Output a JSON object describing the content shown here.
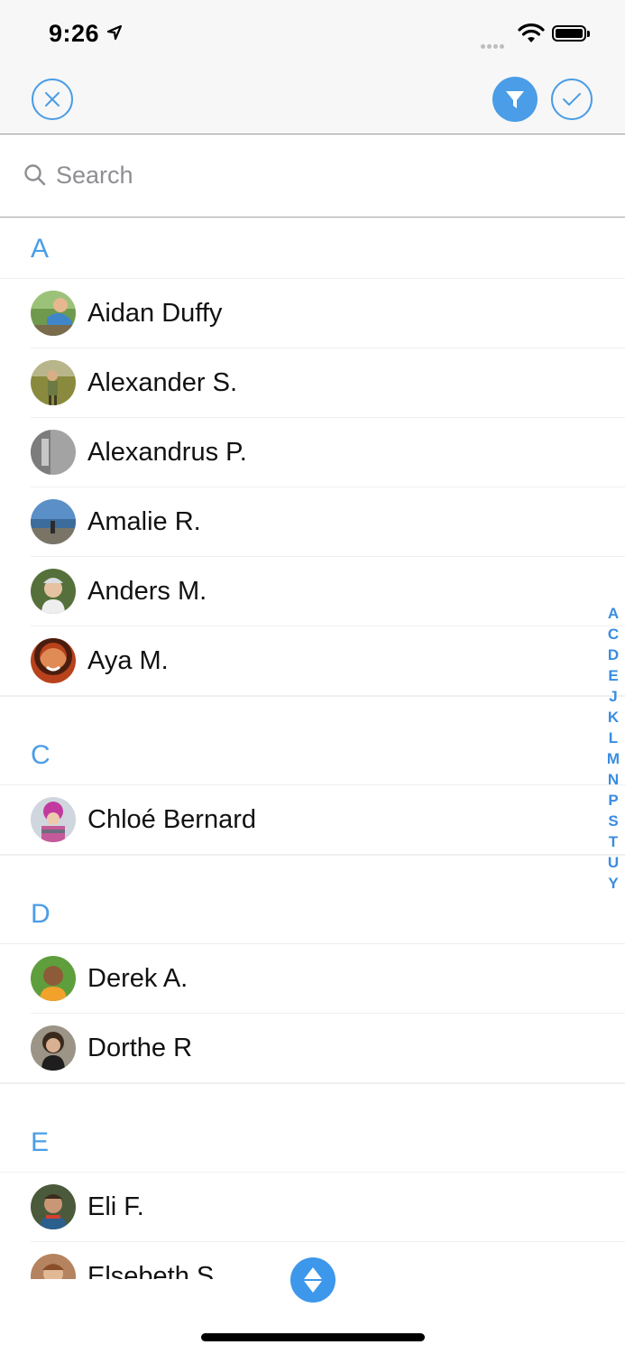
{
  "status_bar": {
    "time": "9:26"
  },
  "search": {
    "placeholder": "Search"
  },
  "colors": {
    "accent": "#4a9de6",
    "index": "#3a8de0"
  },
  "sections": [
    {
      "letter": "A",
      "contacts": [
        "Aidan Duffy",
        "Alexander S.",
        "Alexandrus P.",
        "Amalie R.",
        "Anders M.",
        "Aya M."
      ]
    },
    {
      "letter": "C",
      "contacts": [
        "Chloé Bernard"
      ]
    },
    {
      "letter": "D",
      "contacts": [
        "Derek A.",
        "Dorthe R"
      ]
    },
    {
      "letter": "E",
      "contacts": [
        "Eli F.",
        "Elsebeth S."
      ]
    }
  ],
  "index_letters": [
    "A",
    "C",
    "D",
    "E",
    "J",
    "K",
    "L",
    "M",
    "N",
    "P",
    "S",
    "T",
    "U",
    "Y"
  ]
}
